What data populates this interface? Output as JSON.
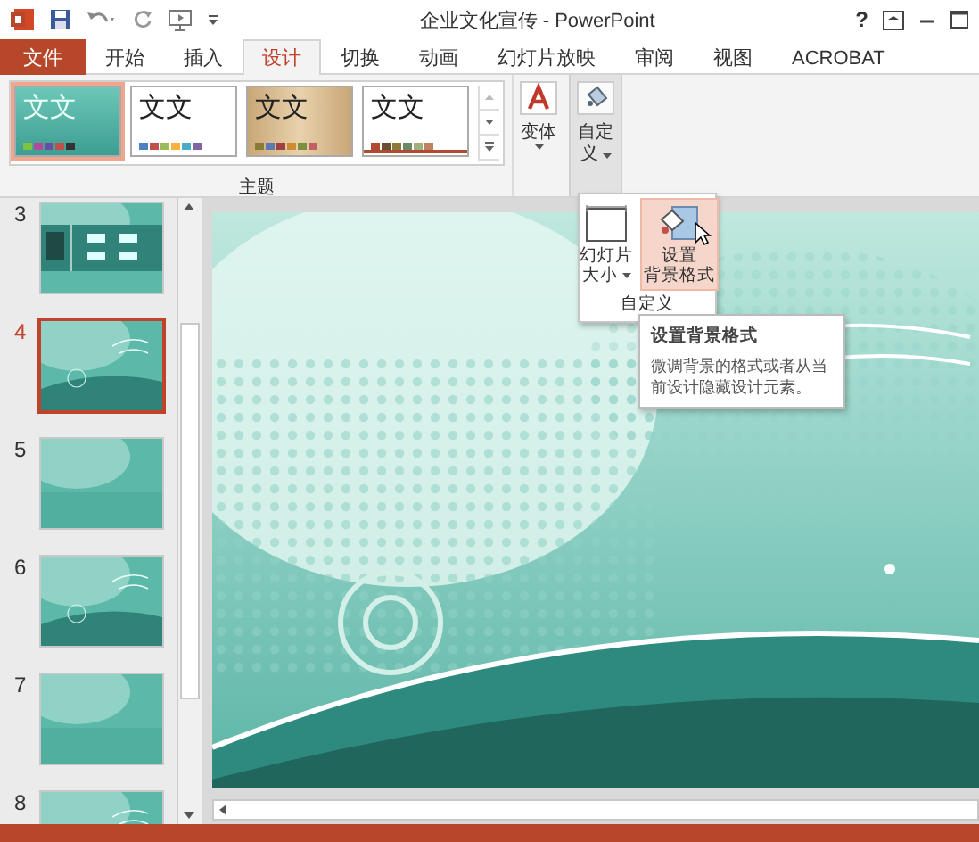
{
  "window": {
    "title": "企业文化宣传 - PowerPoint",
    "help": "?"
  },
  "tabs": [
    {
      "label": "文件",
      "kind": "file",
      "selected": false
    },
    {
      "label": "开始",
      "kind": "tab",
      "selected": false
    },
    {
      "label": "插入",
      "kind": "tab",
      "selected": false
    },
    {
      "label": "设计",
      "kind": "tab",
      "selected": true
    },
    {
      "label": "切换",
      "kind": "tab",
      "selected": false
    },
    {
      "label": "动画",
      "kind": "tab",
      "selected": false
    },
    {
      "label": "幻灯片放映",
      "kind": "tab",
      "selected": false
    },
    {
      "label": "审阅",
      "kind": "tab",
      "selected": false
    },
    {
      "label": "视图",
      "kind": "tab",
      "selected": false
    },
    {
      "label": "ACROBAT",
      "kind": "tab",
      "selected": false
    }
  ],
  "ribbon": {
    "themes": [
      {
        "label": "文文",
        "kind": "teal",
        "selected": true
      },
      {
        "label": "文文",
        "kind": "white",
        "selected": false
      },
      {
        "label": "文文",
        "kind": "wood",
        "selected": false
      },
      {
        "label": "文文",
        "kind": "underline",
        "selected": false
      }
    ],
    "themes_group": "主题",
    "variants_button": "变体",
    "customize_button": [
      "自定",
      "义"
    ]
  },
  "dropdown": {
    "buttons": [
      {
        "label": [
          "幻灯片",
          "大小"
        ],
        "kind": "size",
        "selected": false
      },
      {
        "label": [
          "设置",
          "背景格式"
        ],
        "kind": "background",
        "selected": true
      }
    ],
    "group_label": "自定义"
  },
  "tooltip": {
    "title": "设置背景格式",
    "description": "微调背景的格式或者从当前设计隐藏设计元素。"
  },
  "slides": [
    {
      "number": "3",
      "kind": "table",
      "selected": false
    },
    {
      "number": "4",
      "kind": "swirl",
      "selected": true
    },
    {
      "number": "5",
      "kind": "plain",
      "selected": false
    },
    {
      "number": "6",
      "kind": "swirl",
      "selected": false
    },
    {
      "number": "7",
      "kind": "plain",
      "selected": false
    },
    {
      "number": "8",
      "kind": "swirl",
      "selected": false
    }
  ]
}
